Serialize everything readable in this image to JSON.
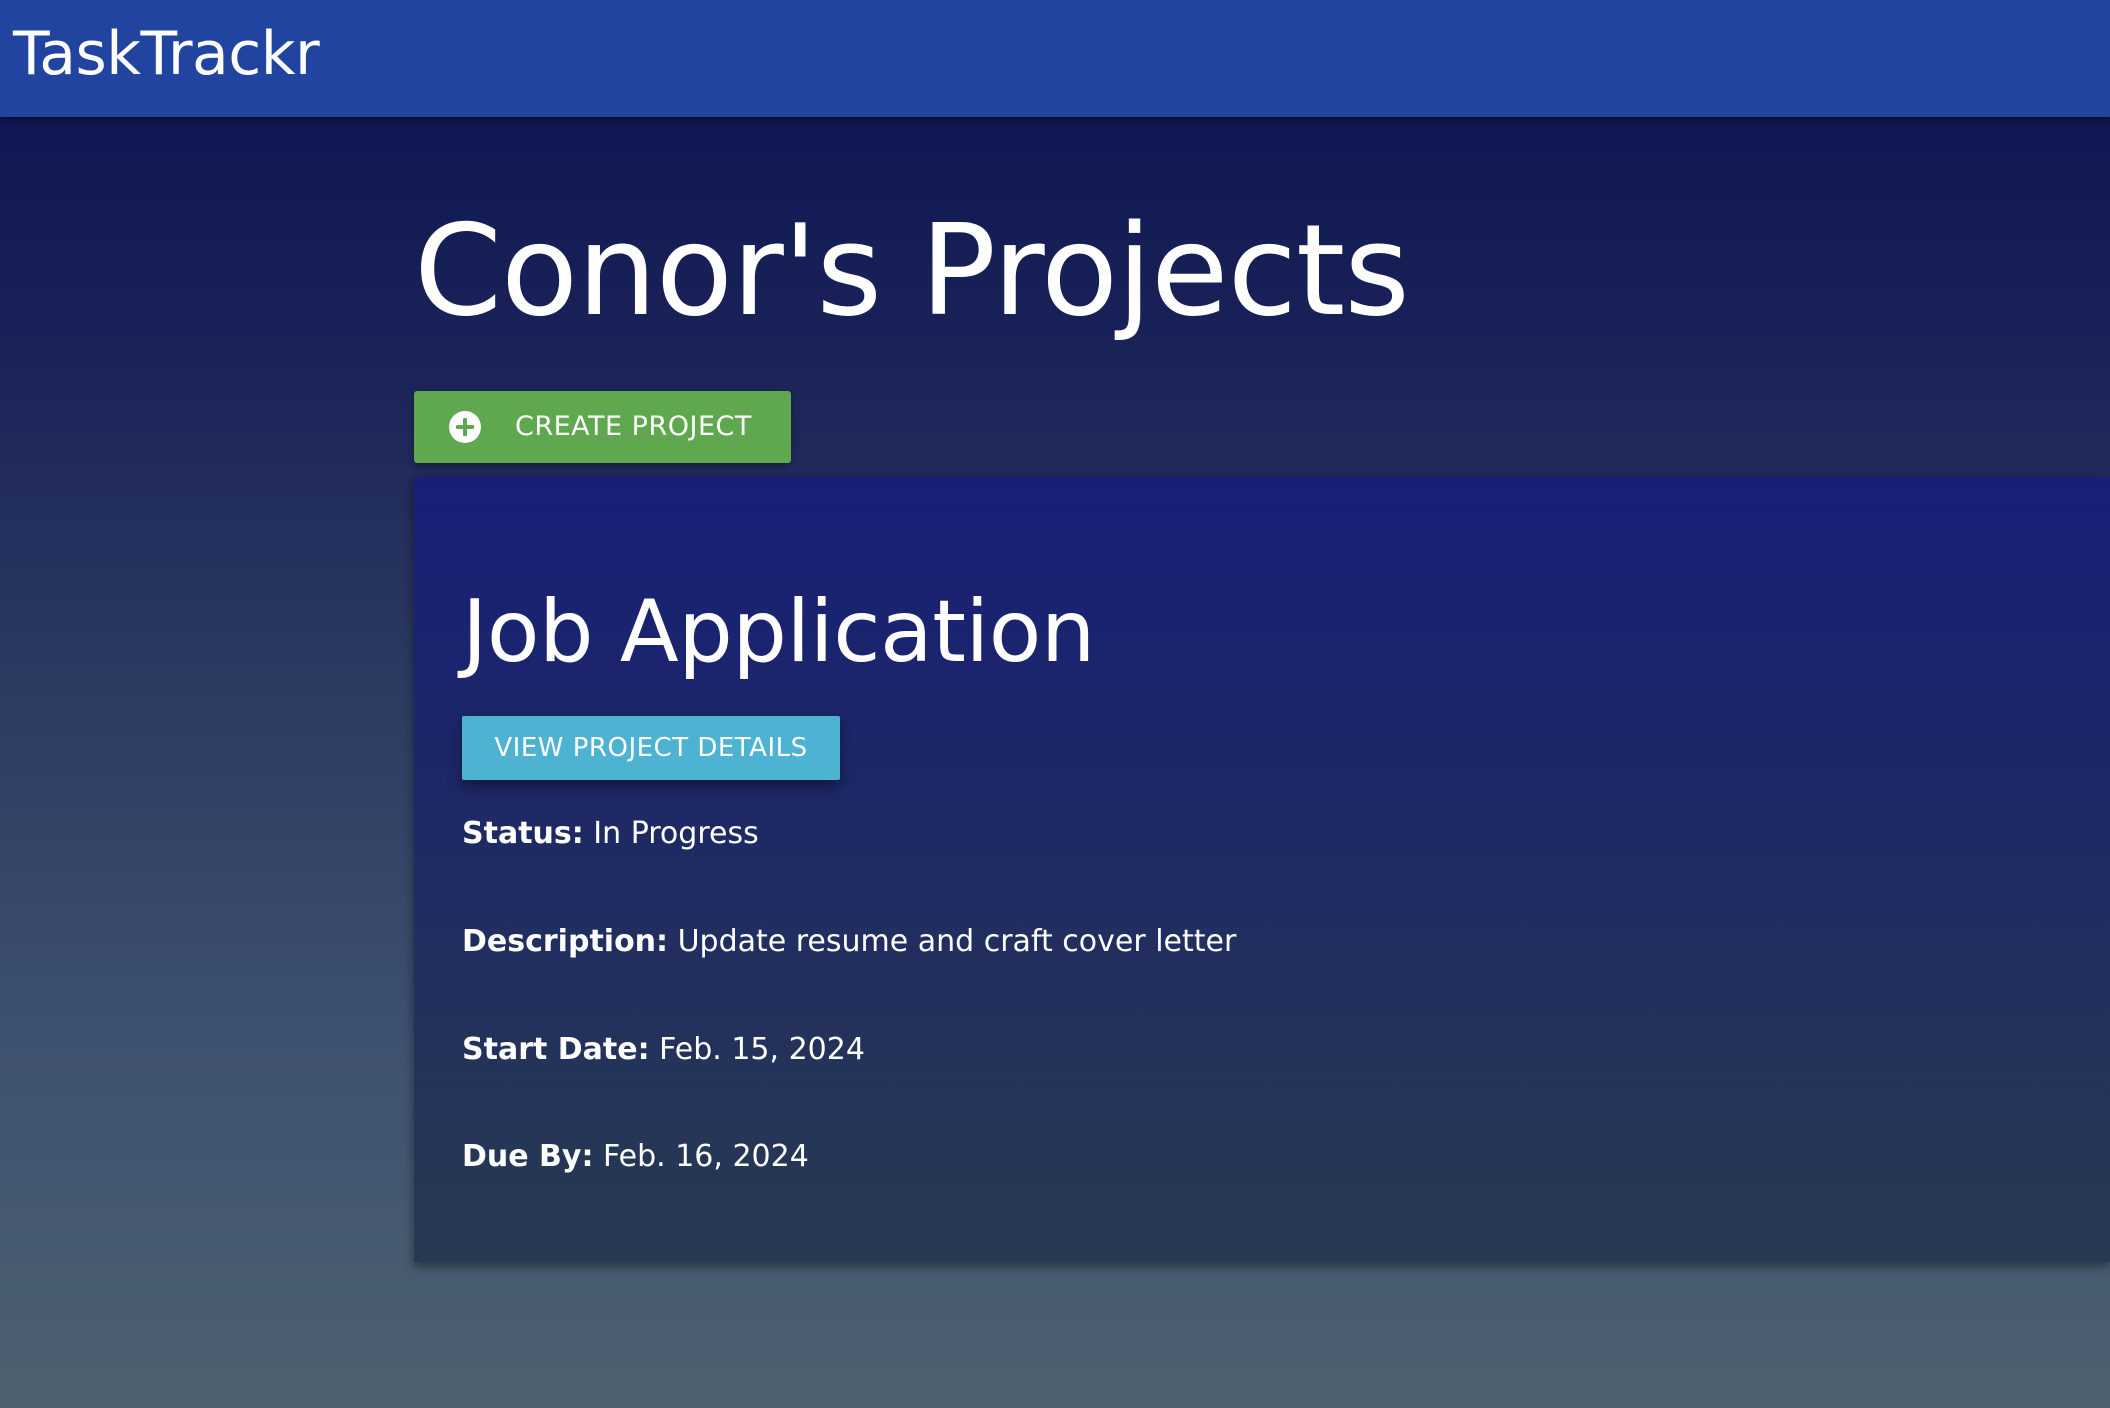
{
  "navbar": {
    "brand": "TaskTrackr"
  },
  "page": {
    "title": "Conor's Projects"
  },
  "actions": {
    "create_label": "CREATE PROJECT",
    "create_icon": "plus-circle-icon"
  },
  "projects": [
    {
      "title": "Job Application",
      "view_label": "VIEW PROJECT DETAILS",
      "fields": [
        {
          "label": "Status:",
          "value": "In Progress"
        },
        {
          "label": "Description:",
          "value": "Update resume and craft cover letter"
        },
        {
          "label": "Start Date:",
          "value": "Feb. 15, 2024"
        },
        {
          "label": "Due By:",
          "value": "Feb. 16, 2024"
        }
      ]
    }
  ],
  "colors": {
    "navbar": "#2044a0",
    "create_button": "#5fa84f",
    "view_button": "#4eb2d2",
    "card_top": "#181f78"
  }
}
